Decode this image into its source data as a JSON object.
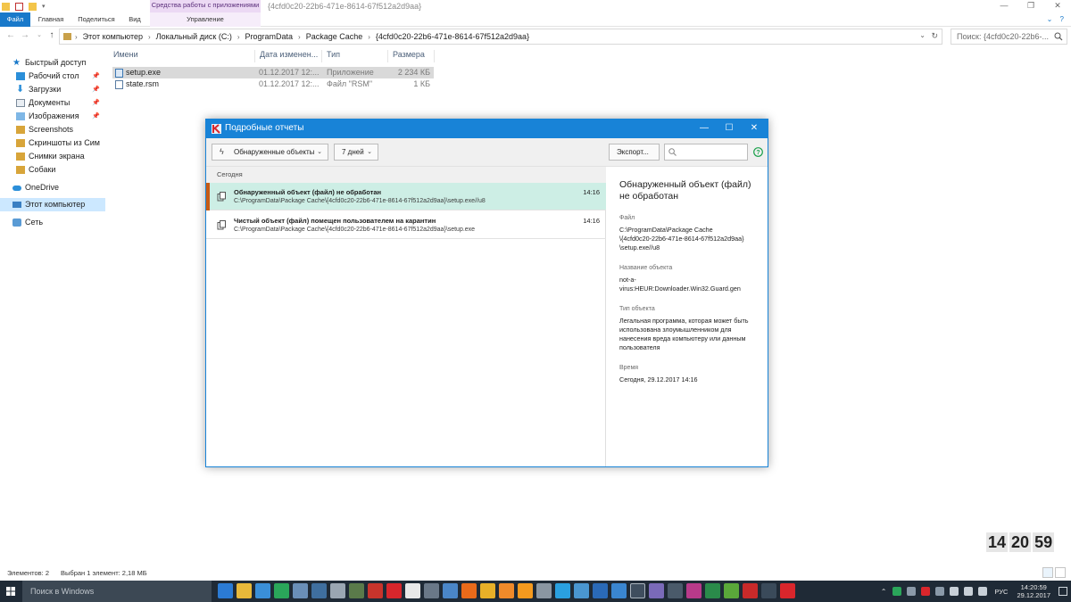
{
  "explorer": {
    "window_title": "{4cfd0c20-22b6-471e-8614-67f512a2d9aa}",
    "context_tab_header": "Средства работы с приложениями",
    "ribbon_tabs": {
      "file": "Файл",
      "home": "Главная",
      "share": "Поделиться",
      "view": "Вид",
      "manage": "Управление"
    },
    "breadcrumb": [
      "Этот компьютер",
      "Локальный диск (C:)",
      "ProgramData",
      "Package Cache",
      "{4cfd0c20-22b6-471e-8614-67f512a2d9aa}"
    ],
    "search_placeholder": "Поиск: {4cfd0c20-22b6-...",
    "nav": {
      "quick_access": "Быстрый доступ",
      "items": [
        {
          "label": "Рабочий стол",
          "icon": "desktop-folder-icon",
          "pinned": true
        },
        {
          "label": "Загрузки",
          "icon": "downloads-icon",
          "pinned": true
        },
        {
          "label": "Документы",
          "icon": "documents-icon",
          "pinned": true
        },
        {
          "label": "Изображения",
          "icon": "pictures-icon",
          "pinned": true
        },
        {
          "label": "Screenshots",
          "icon": "folder-icon",
          "pinned": false
        },
        {
          "label": "Скриншоты из Сим",
          "icon": "folder-icon",
          "pinned": false
        },
        {
          "label": "Снимки экрана",
          "icon": "folder-icon",
          "pinned": false
        },
        {
          "label": "Собаки",
          "icon": "folder-icon",
          "pinned": false
        }
      ],
      "onedrive": "OneDrive",
      "this_pc": "Этот компьютер",
      "network": "Сеть"
    },
    "columns": [
      "Имени",
      "Дата изменен...",
      "Тип",
      "Размера"
    ],
    "files": [
      {
        "name": "setup.exe",
        "date": "01.12.2017 12:...",
        "type": "Приложение",
        "size": "2 234 КБ",
        "selected": true
      },
      {
        "name": "state.rsm",
        "date": "01.12.2017 12:...",
        "type": "Файл \"RSM\"",
        "size": "1 КБ",
        "selected": false
      }
    ],
    "status": {
      "items": "Элементов: 2",
      "selected": "Выбран 1 элемент: 2,18 МБ"
    }
  },
  "dialog": {
    "title": "Подробные отчеты",
    "filter_objects": "Обнаруженные объекты",
    "filter_days": "7 дней",
    "export": "Экспорт...",
    "group_label": "Сегодня",
    "events": [
      {
        "title": "Обнаруженный объект (файл) не обработан",
        "path": "C:\\ProgramData\\Package Cache\\{4cfd0c20-22b6-471e-8614-67f512a2d9aa}\\setup.exe//u8",
        "time": "14:16",
        "selected": true
      },
      {
        "title": "Чистый объект (файл) помещен пользователем на карантин",
        "path": "C:\\ProgramData\\Package Cache\\{4cfd0c20-22b6-471e-8614-67f512a2d9aa}\\setup.exe",
        "time": "14:16",
        "selected": false
      }
    ],
    "details": {
      "heading": "Обнаруженный объект (файл) не обработан",
      "file_label": "Файл",
      "file_value": "C:\\ProgramData\\Package Cache\n\\{4cfd0c20-22b6-471e-8614-67f512a2d9aa}\n\\setup.exe//u8",
      "object_label": "Название объекта",
      "object_value": "not-a-\nvirus:HEUR:Downloader.Win32.Guard.gen",
      "type_label": "Тип объекта",
      "type_value": "Легальная программа, которая может быть использована злоумышленником для нанесения вреда компьютеру или данным пользователя",
      "time_label": "Время",
      "time_value": "Сегодня, 29.12.2017 14:16"
    }
  },
  "clock_widget": {
    "hours": "14",
    "minutes": "20",
    "seconds": "59"
  },
  "taskbar": {
    "search_placeholder": "Поиск в Windows",
    "language": "РУС",
    "time": "14:20:59",
    "date": "29.12.2017"
  },
  "colors": {
    "accent": "#1883d7",
    "selected_event": "#cdeee5",
    "threat_marker": "#c85a14",
    "taskbar": "#1f2a36"
  }
}
